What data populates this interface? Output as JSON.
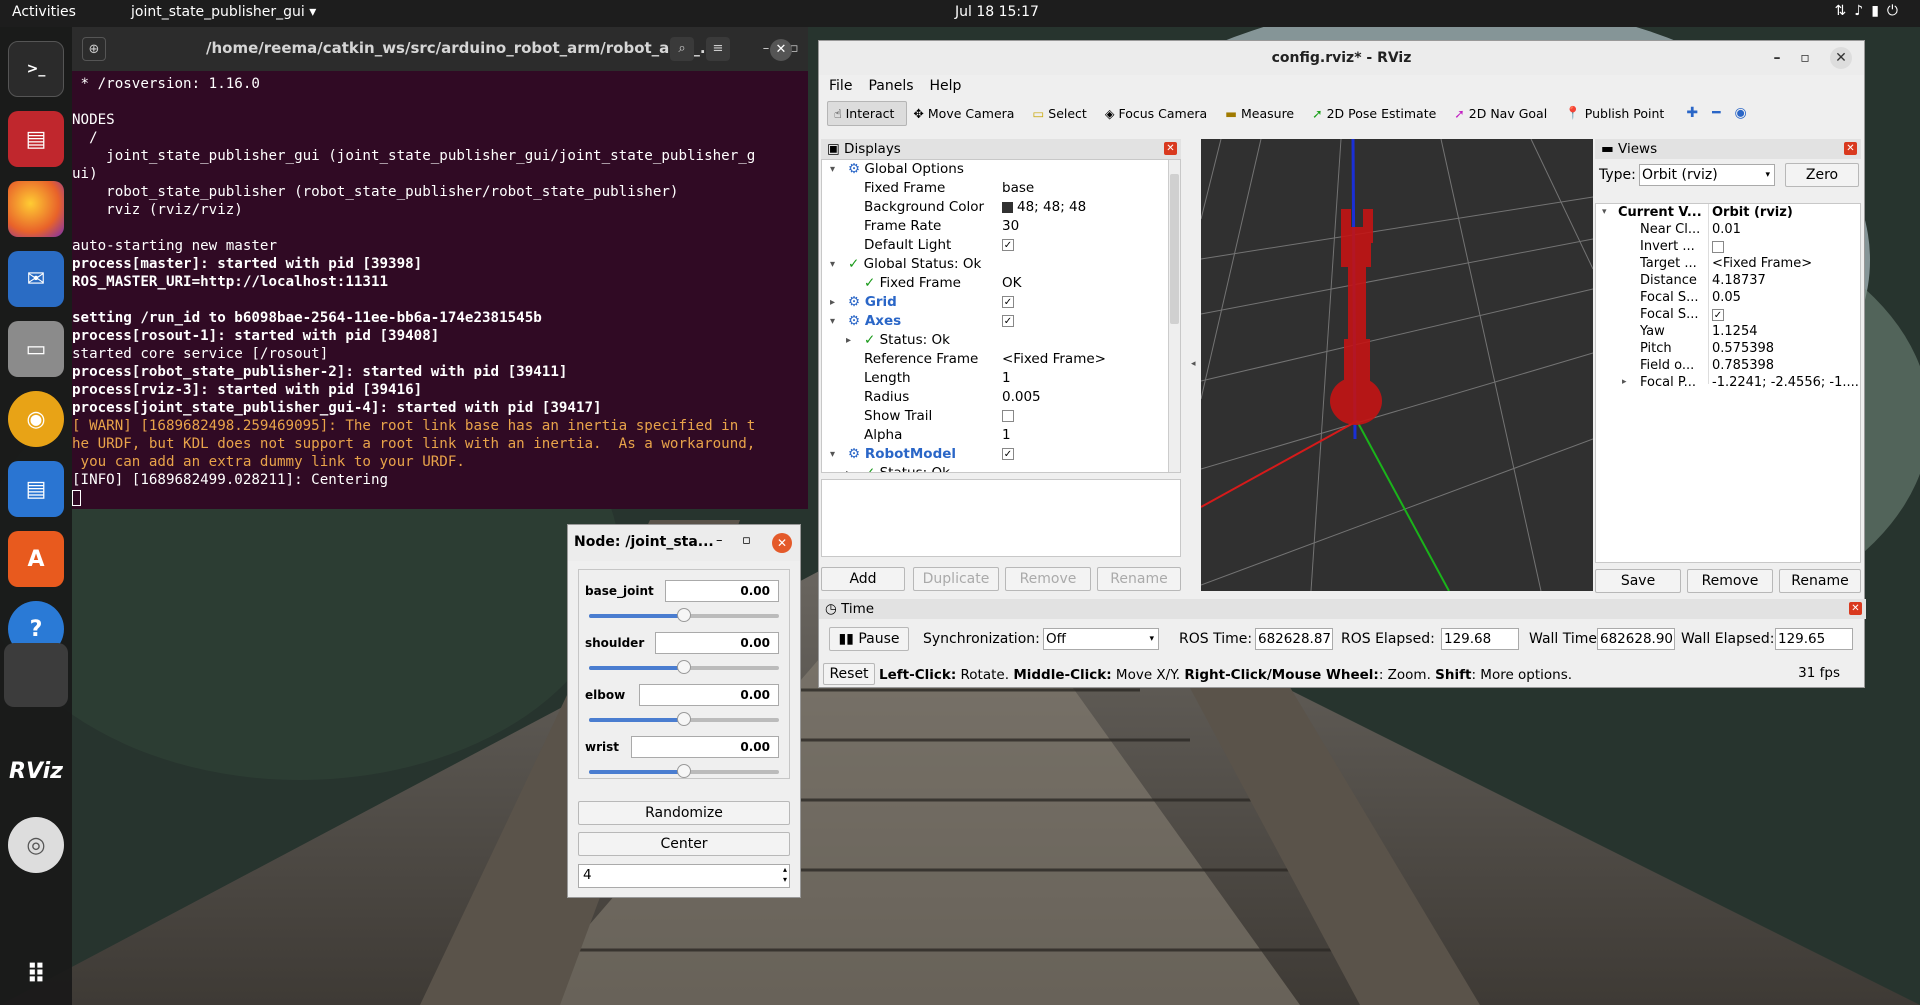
{
  "topbar": {
    "activities": "Activities",
    "app_menu": "joint_state_publisher_gui ▾",
    "clock": "Jul 18  15:17"
  },
  "terminal": {
    "path": "/home/reema/catkin_ws/src/arduino_robot_arm/robot_arm_...",
    "lines": [
      {
        "t": " * /rosversion: 1.16.0",
        "c": ""
      },
      {
        "t": "",
        "c": ""
      },
      {
        "t": "NODES",
        "c": ""
      },
      {
        "t": "  /",
        "c": ""
      },
      {
        "t": "    joint_state_publisher_gui (joint_state_publisher_gui/joint_state_publisher_g",
        "c": ""
      },
      {
        "t": "ui)",
        "c": ""
      },
      {
        "t": "    robot_state_publisher (robot_state_publisher/robot_state_publisher)",
        "c": ""
      },
      {
        "t": "    rviz (rviz/rviz)",
        "c": ""
      },
      {
        "t": "",
        "c": ""
      },
      {
        "t": "auto-starting new master",
        "c": ""
      },
      {
        "t": "process[master]: started with pid [39398]",
        "c": "b"
      },
      {
        "t": "ROS_MASTER_URI=http://localhost:11311",
        "c": "b"
      },
      {
        "t": "",
        "c": ""
      },
      {
        "t": "setting /run_id to b6098bae-2564-11ee-bb6a-174e2381545b",
        "c": "b"
      },
      {
        "t": "process[rosout-1]: started with pid [39408]",
        "c": "b"
      },
      {
        "t": "started core service [/rosout]",
        "c": ""
      },
      {
        "t": "process[robot_state_publisher-2]: started with pid [39411]",
        "c": "b"
      },
      {
        "t": "process[rviz-3]: started with pid [39416]",
        "c": "b"
      },
      {
        "t": "process[joint_state_publisher_gui-4]: started with pid [39417]",
        "c": "b"
      },
      {
        "t": "[ WARN] [1689682498.259469095]: The root link base has an inertia specified in t",
        "c": "w"
      },
      {
        "t": "he URDF, but KDL does not support a root link with an inertia.  As a workaround,",
        "c": "w"
      },
      {
        "t": " you can add an extra dummy link to your URDF.",
        "c": "w"
      },
      {
        "t": "[INFO] [1689682499.028211]: Centering",
        "c": ""
      }
    ]
  },
  "rviz": {
    "title": "config.rviz* - RViz",
    "menu": [
      "File",
      "Panels",
      "Help"
    ],
    "tools": [
      {
        "label": "Interact",
        "icon": "cursor-icon",
        "active": true
      },
      {
        "label": "Move Camera",
        "icon": "move-icon",
        "active": false
      },
      {
        "label": "Select",
        "icon": "select-icon",
        "active": false
      },
      {
        "label": "Focus Camera",
        "icon": "focus-icon",
        "active": false
      },
      {
        "label": "Measure",
        "icon": "ruler-icon",
        "active": false
      },
      {
        "label": "2D Pose Estimate",
        "icon": "green-arrow-icon",
        "active": false
      },
      {
        "label": "2D Nav Goal",
        "icon": "pink-arrow-icon",
        "active": false
      },
      {
        "label": "Publish Point",
        "icon": "pin-icon",
        "active": false
      }
    ],
    "displays": {
      "title": "Displays",
      "rows": [
        {
          "k": "Global Options",
          "v": "",
          "indent": 1,
          "exp": "▾",
          "cls": ""
        },
        {
          "k": "Fixed Frame",
          "v": "base",
          "indent": 2,
          "exp": "",
          "cls": ""
        },
        {
          "k": "Background Color",
          "v": "48; 48; 48",
          "indent": 2,
          "exp": "",
          "cls": "",
          "swatch": true
        },
        {
          "k": "Frame Rate",
          "v": "30",
          "indent": 2,
          "exp": "",
          "cls": ""
        },
        {
          "k": "Default Light",
          "v": "",
          "indent": 2,
          "exp": "",
          "cls": "",
          "check": true
        },
        {
          "k": "Global Status: Ok",
          "v": "",
          "indent": 1,
          "exp": "▾",
          "cls": "",
          "tick": true
        },
        {
          "k": "Fixed Frame",
          "v": "OK",
          "indent": 2,
          "exp": "",
          "cls": "",
          "tick": true
        },
        {
          "k": "Grid",
          "v": "",
          "indent": 1,
          "exp": "▸",
          "cls": "blue",
          "check": true
        },
        {
          "k": "Axes",
          "v": "",
          "indent": 1,
          "exp": "▾",
          "cls": "blue",
          "check": true
        },
        {
          "k": "Status: Ok",
          "v": "",
          "indent": 2,
          "exp": "▸",
          "cls": "",
          "tick": true
        },
        {
          "k": "Reference Frame",
          "v": "<Fixed Frame>",
          "indent": 2,
          "exp": "",
          "cls": ""
        },
        {
          "k": "Length",
          "v": "1",
          "indent": 2,
          "exp": "",
          "cls": ""
        },
        {
          "k": "Radius",
          "v": "0.005",
          "indent": 2,
          "exp": "",
          "cls": ""
        },
        {
          "k": "Show Trail",
          "v": "",
          "indent": 2,
          "exp": "",
          "cls": "",
          "check": false
        },
        {
          "k": "Alpha",
          "v": "1",
          "indent": 2,
          "exp": "",
          "cls": ""
        },
        {
          "k": "RobotModel",
          "v": "",
          "indent": 1,
          "exp": "▾",
          "cls": "blue",
          "check": true
        },
        {
          "k": "Status: Ok",
          "v": "",
          "indent": 2,
          "exp": "▸",
          "cls": "",
          "tick": true
        }
      ],
      "buttons": [
        "Add",
        "Duplicate",
        "Remove",
        "Rename"
      ]
    },
    "views": {
      "title": "Views",
      "type_label": "Type:",
      "type_value": "Orbit (rviz)",
      "zero": "Zero",
      "rows": [
        {
          "k": "Current V...",
          "v": "Orbit (rviz)",
          "bold": true
        },
        {
          "k": "Near Cl...",
          "v": "0.01"
        },
        {
          "k": "Invert ...",
          "v": ""
        },
        {
          "k": "Target ...",
          "v": "<Fixed Frame>"
        },
        {
          "k": "Distance",
          "v": "4.18737"
        },
        {
          "k": "Focal S...",
          "v": "0.05"
        },
        {
          "k": "Focal S...",
          "v": "✓"
        },
        {
          "k": "Yaw",
          "v": "1.1254"
        },
        {
          "k": "Pitch",
          "v": "0.575398"
        },
        {
          "k": "Field o...",
          "v": "0.785398"
        },
        {
          "k": "Focal P...",
          "v": "-1.2241; -2.4556; -1...."
        }
      ],
      "buttons": [
        "Save",
        "Remove",
        "Rename"
      ]
    },
    "time": {
      "title": "Time",
      "pause": "Pause",
      "sync_label": "Synchronization:",
      "sync_value": "Off",
      "ros_time_label": "ROS Time:",
      "ros_time": "682628.87",
      "ros_elapsed_label": "ROS Elapsed:",
      "ros_elapsed": "129.68",
      "wall_time_label": "Wall Time:",
      "wall_time": "682628.90",
      "wall_elapsed_label": "Wall Elapsed:",
      "wall_elapsed": "129.65",
      "reset": "Reset",
      "help_b1": "Left-Click:",
      "help_t1": " Rotate. ",
      "help_b2": "Middle-Click:",
      "help_t2": " Move X/Y. ",
      "help_b3": "Right-Click/Mouse Wheel:",
      "help_t3": ": Zoom. ",
      "help_b4": "Shift",
      "help_t4": ": More options.",
      "fps": "31 fps"
    }
  },
  "jsp": {
    "title": "Node: /joint_sta...",
    "joints": [
      {
        "name": "base_joint",
        "value": "0.00",
        "level": 0.5
      },
      {
        "name": "shoulder",
        "value": "0.00",
        "level": 0.5
      },
      {
        "name": "elbow",
        "value": "0.00",
        "level": 0.5
      },
      {
        "name": "wrist",
        "value": "0.00",
        "level": 0.5
      }
    ],
    "randomize": "Randomize",
    "center": "Center",
    "spin": "4"
  },
  "colors": {
    "terminal_bg": "#300a24",
    "rviz_bg": "#303030",
    "robot": "#d11818",
    "warn": "#e8a34a"
  }
}
